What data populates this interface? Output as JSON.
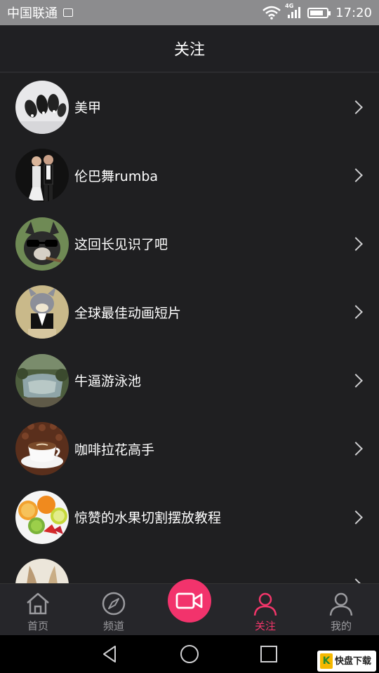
{
  "status_bar": {
    "carrier": "中国联通",
    "network": "4G",
    "time": "17:20"
  },
  "header": {
    "title": "关注"
  },
  "list": {
    "items": [
      {
        "label": "美甲",
        "avatar": "nail-art-avatar"
      },
      {
        "label": "伦巴舞rumba",
        "avatar": "dancers-avatar"
      },
      {
        "label": "这回长见识了吧",
        "avatar": "dog-sunglasses-avatar"
      },
      {
        "label": "全球最佳动画短片",
        "avatar": "cartoon-cat-avatar"
      },
      {
        "label": "牛逼游泳池",
        "avatar": "pool-avatar"
      },
      {
        "label": "咖啡拉花高手",
        "avatar": "coffee-avatar"
      },
      {
        "label": "惊赞的水果切割摆放教程",
        "avatar": "fruit-avatar"
      },
      {
        "label": "",
        "avatar": "partial-avatar"
      }
    ]
  },
  "tabbar": {
    "tabs": [
      {
        "label": "首页",
        "icon": "home-icon"
      },
      {
        "label": "频道",
        "icon": "compass-icon"
      },
      {
        "label": "",
        "icon": "record-icon"
      },
      {
        "label": "关注",
        "icon": "user-icon",
        "active": true
      },
      {
        "label": "我的",
        "icon": "profile-icon"
      }
    ],
    "accent": "#f2336c"
  },
  "watermark": {
    "text": "快盘下载"
  }
}
